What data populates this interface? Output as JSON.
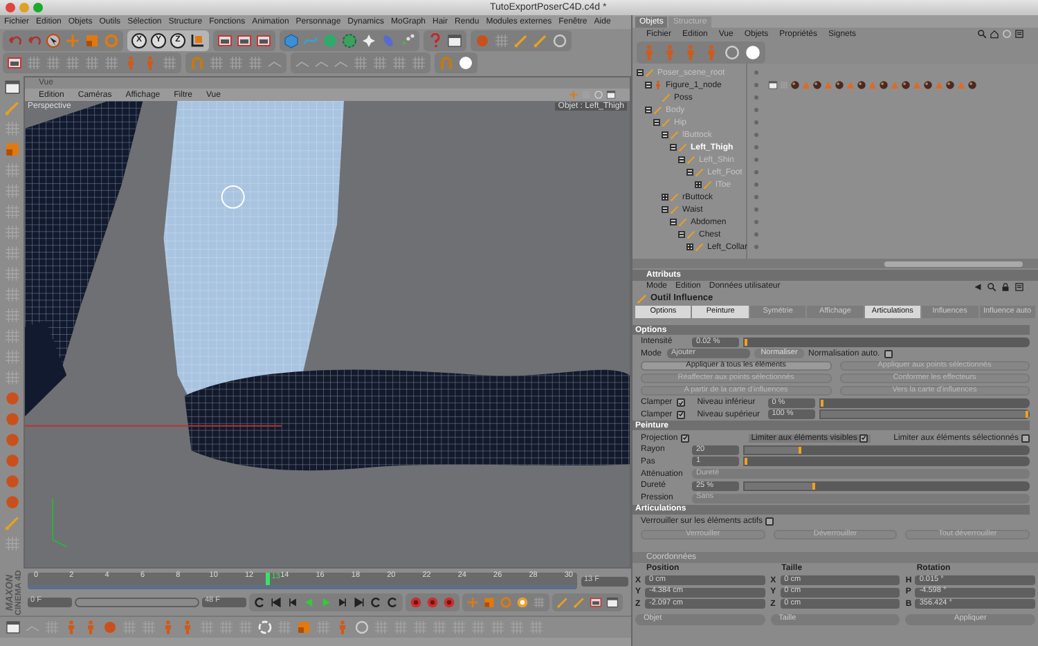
{
  "window": {
    "title": "TutoExportPoserC4D.c4d *"
  },
  "menu_bar": [
    "Fichier",
    "Edition",
    "Objets",
    "Outils",
    "Sélection",
    "Structure",
    "Fonctions",
    "Animation",
    "Personnage",
    "Dynamics",
    "MoGraph",
    "Hair",
    "Rendu",
    "Modules externes",
    "Fenêtre",
    "Aide"
  ],
  "toolbar": {
    "axis_buttons": [
      "X",
      "Y",
      "Z"
    ]
  },
  "viewport": {
    "title": "Vue",
    "menu": [
      "Edition",
      "Caméras",
      "Affichage",
      "Filtre",
      "Vue"
    ],
    "camera": "Perspective",
    "info": "Objet : Left_Thigh"
  },
  "logo": [
    "MAXON",
    "CINEMA 4D"
  ],
  "timeline": {
    "ticks": [
      "0",
      "2",
      "4",
      "6",
      "8",
      "10",
      "12",
      "14",
      "16",
      "18",
      "20",
      "22",
      "24",
      "26",
      "28",
      "30"
    ],
    "current": "13",
    "level": 0.433,
    "current_field": "13 F",
    "start_field": "0 F",
    "end_field": "48 F",
    "range": {
      "level": 1
    }
  },
  "object_manager": {
    "tabs": [
      {
        "label": "Objets",
        "selected": true
      },
      {
        "label": "Structure",
        "selected": false
      }
    ],
    "menu": [
      "Fichier",
      "Edition",
      "Vue",
      "Objets",
      "Propriétés",
      "Signets"
    ],
    "tree": [
      {
        "name": "Poser_scene_root",
        "dimmed": true,
        "selected": false,
        "expanded": true,
        "children": [
          {
            "name": "Figure_1_node",
            "dimmed": false,
            "selected": false,
            "expanded": true,
            "children": [
              {
                "name": "Poss",
                "dimmed": false,
                "selected": false
              }
            ]
          },
          {
            "name": "Body",
            "dimmed": true,
            "selected": false,
            "expanded": true,
            "children": [
              {
                "name": "Hip",
                "dimmed": true,
                "selected": false,
                "expanded": true,
                "children": [
                  {
                    "name": "lButtock",
                    "dimmed": true,
                    "selected": false,
                    "expanded": true,
                    "children": [
                      {
                        "name": "Left_Thigh",
                        "dimmed": false,
                        "selected": true,
                        "expanded": true,
                        "children": [
                          {
                            "name": "Left_Shin",
                            "dimmed": true,
                            "selected": false,
                            "expanded": true,
                            "children": [
                              {
                                "name": "Left_Foot",
                                "dimmed": true,
                                "selected": false,
                                "expanded": true,
                                "children": [
                                  {
                                    "name": "lToe",
                                    "dimmed": true,
                                    "selected": false,
                                    "expanded": false
                                  }
                                ]
                              }
                            ]
                          }
                        ]
                      }
                    ]
                  },
                  {
                    "name": "rButtock",
                    "dimmed": false,
                    "selected": false,
                    "expanded": false
                  },
                  {
                    "name": "Waist",
                    "dimmed": false,
                    "selected": false,
                    "expanded": true,
                    "children": [
                      {
                        "name": "Abdomen",
                        "dimmed": false,
                        "selected": false,
                        "expanded": true,
                        "children": [
                          {
                            "name": "Chest",
                            "dimmed": false,
                            "selected": false,
                            "expanded": true,
                            "children": [
                              {
                                "name": "Left_Collar",
                                "dimmed": false,
                                "selected": false,
                                "expanded": false
                              }
                            ]
                          }
                        ]
                      }
                    ]
                  }
                ]
              }
            ]
          }
        ]
      }
    ]
  },
  "attributes": {
    "title": "Attributs",
    "menu": [
      "Mode",
      "Edition",
      "Données utilisateur"
    ],
    "tool": "Outil Influence",
    "tabs": [
      {
        "label": "Options",
        "selected": true
      },
      {
        "label": "Peinture",
        "selected": true
      },
      {
        "label": "Symétrie",
        "selected": false
      },
      {
        "label": "Affichage",
        "selected": false
      },
      {
        "label": "Articulations",
        "selected": true
      },
      {
        "label": "Influences",
        "selected": false
      },
      {
        "label": "Influence auto",
        "selected": false
      }
    ],
    "sections": [
      {
        "title": "Options",
        "rows": [
          {
            "kind": "slider",
            "label": "Intensité",
            "value": "0.02 %",
            "level": 0.0002
          },
          {
            "kind": "mode",
            "label": "Mode",
            "value": "Ajouter",
            "button": "Normaliser",
            "check_label": "Normalisation auto.",
            "checked": false
          },
          {
            "kind": "buttons",
            "buttons": [
              {
                "label": "Appliquer à tous les éléments",
                "disabled": false
              },
              {
                "label": "Appliquer aux points sélectionnés",
                "disabled": true
              }
            ]
          },
          {
            "kind": "buttons",
            "buttons": [
              {
                "label": "Réaffecter aux points sélectionnés",
                "disabled": true
              },
              {
                "label": "Conformer les effecteurs",
                "disabled": true
              }
            ]
          },
          {
            "kind": "buttons",
            "buttons": [
              {
                "label": "A partir de la carte d'influences",
                "disabled": true
              },
              {
                "label": "Vers la carte d'influences",
                "disabled": true
              }
            ]
          },
          {
            "kind": "clamp",
            "label": "Clamper",
            "checked": true,
            "sublabel": "Niveau inférieur",
            "value": "0 %",
            "level": 0
          },
          {
            "kind": "clamp",
            "label": "Clamper",
            "checked": true,
            "sublabel": "Niveau supérieur",
            "value": "100 %",
            "level": 1
          }
        ]
      },
      {
        "title": "Peinture",
        "rows": [
          {
            "kind": "checks",
            "items": [
              {
                "label": "Projection",
                "checked": true
              },
              {
                "label": "Limiter aux éléments visibles",
                "checked": true
              },
              {
                "label": "Limiter aux éléments sélectionnés",
                "checked": false
              }
            ]
          },
          {
            "kind": "slider",
            "label": "Rayon",
            "value": "20",
            "level": 0.2
          },
          {
            "kind": "slider",
            "label": "Pas",
            "value": "1",
            "level": 0.01
          },
          {
            "kind": "dropdown",
            "label": "Atténuation",
            "value": "Dureté"
          },
          {
            "kind": "slider",
            "label": "Dureté",
            "value": "25 %",
            "level": 0.25
          },
          {
            "kind": "dropdown",
            "label": "Pression",
            "value": "Sans"
          }
        ]
      },
      {
        "title": "Articulations",
        "rows": [
          {
            "kind": "checks",
            "items": [
              {
                "label": "Verrouiller sur les éléments actifs",
                "checked": false
              }
            ]
          },
          {
            "kind": "buttons",
            "buttons": [
              {
                "label": "Verrouiller",
                "disabled": true
              },
              {
                "label": "Déverrouiller",
                "disabled": true
              },
              {
                "label": "Tout déverrouiller",
                "disabled": true
              }
            ]
          }
        ]
      }
    ]
  },
  "coordinates": {
    "title": "Coordonnées",
    "columns": [
      {
        "heading": "Position",
        "fields": [
          {
            "axis": "X",
            "value": "0 cm"
          },
          {
            "axis": "Y",
            "value": "-4.384 cm"
          },
          {
            "axis": "Z",
            "value": "-2.097 cm"
          }
        ],
        "footer": {
          "kind": "dropdown",
          "label": "Objet"
        }
      },
      {
        "heading": "Taille",
        "fields": [
          {
            "axis": "X",
            "value": "0 cm"
          },
          {
            "axis": "Y",
            "value": "0 cm"
          },
          {
            "axis": "Z",
            "value": "0 cm"
          }
        ],
        "footer": {
          "kind": "dropdown",
          "label": "Taille"
        }
      },
      {
        "heading": "Rotation",
        "fields": [
          {
            "axis": "H",
            "value": "0.015 °"
          },
          {
            "axis": "P",
            "value": "-4.598 °"
          },
          {
            "axis": "B",
            "value": "356.424 °"
          }
        ],
        "footer": {
          "kind": "button",
          "label": "Appliquer"
        }
      }
    ]
  }
}
